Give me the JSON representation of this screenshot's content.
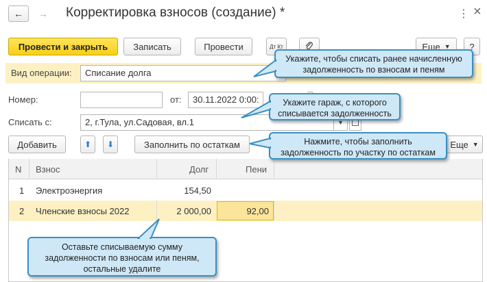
{
  "window": {
    "title": "Корректировка взносов (создание) *",
    "back_icon": "←",
    "forward_icon": "→",
    "menu_icon": "⋮",
    "close_icon": "×"
  },
  "toolbar": {
    "post_close_label": "Провести и закрыть",
    "save_label": "Записать",
    "post_label": "Провести",
    "dt_kt_label": "Дт Кт",
    "more_label": "Еще",
    "help_label": "?"
  },
  "form": {
    "operation_label": "Вид операции:",
    "operation_value": "Списание долга",
    "number_label": "Номер:",
    "number_value": "",
    "date_label": "от:",
    "date_value": "30.11.2022  0:00:",
    "writeoff_label": "Списать с:",
    "writeoff_value": "2, г.Тула, ул.Садовая, вл.1"
  },
  "table_toolbar": {
    "add_label": "Добавить",
    "fill_label": "Заполнить по остаткам",
    "more_label": "Еще"
  },
  "table": {
    "columns": [
      "N",
      "Взнос",
      "Долг",
      "Пени"
    ],
    "rows": [
      {
        "n": "1",
        "vznos": "Электроэнергия",
        "dolg": "154,50",
        "peni": ""
      },
      {
        "n": "2",
        "vznos": "Членские взносы 2022",
        "dolg": "2 000,00",
        "peni": "92,00"
      }
    ]
  },
  "callouts": {
    "c1": "Укажите, чтобы списать ранее начисленную задолженность по взносам и пеням",
    "c2": "Укажите гараж, с которого списывается задолженность",
    "c3": "Нажмите, чтобы заполнить задолженность по участку по остаткам",
    "c4": "Оставьте списываемую сумму задолженности по взносам или пеням, остальные удалите"
  },
  "colors": {
    "primary_button": "#f7cf18",
    "highlight_row": "#fdf1c4",
    "operation_row": "#fdf1c4",
    "callout_fill": "#cfe8f7",
    "callout_border": "#3a8fc2"
  }
}
